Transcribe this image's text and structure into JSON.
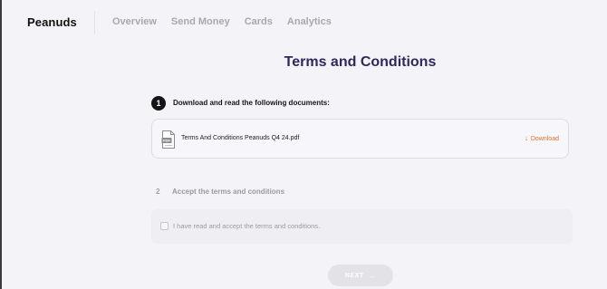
{
  "header": {
    "logo": "Peanuds",
    "nav": [
      {
        "label": "Overview"
      },
      {
        "label": "Send Money"
      },
      {
        "label": "Cards"
      },
      {
        "label": "Analytics"
      }
    ]
  },
  "main": {
    "title": "Terms and Conditions",
    "step1": {
      "number": "1",
      "label": "Download and read the following documents:",
      "document": {
        "icon": "pdf-file-icon",
        "icon_text": "PDF",
        "name": "Terms And Conditions Peanuds Q4 24.pdf",
        "download_label": "Download",
        "download_icon": "arrow-down-icon"
      }
    },
    "step2": {
      "number": "2",
      "label": "Accept the terms and conditions",
      "checkbox_label": "I have read and accept the terms and conditions.",
      "checked": false
    },
    "next_button": {
      "label": "NEXT",
      "icon": "arrow-right-icon"
    }
  },
  "colors": {
    "background": "#f4f3f7",
    "title": "#2d2a5c",
    "download": "#e0702a",
    "step_badge": "#151515",
    "disabled_button": "#e3e2e7"
  }
}
